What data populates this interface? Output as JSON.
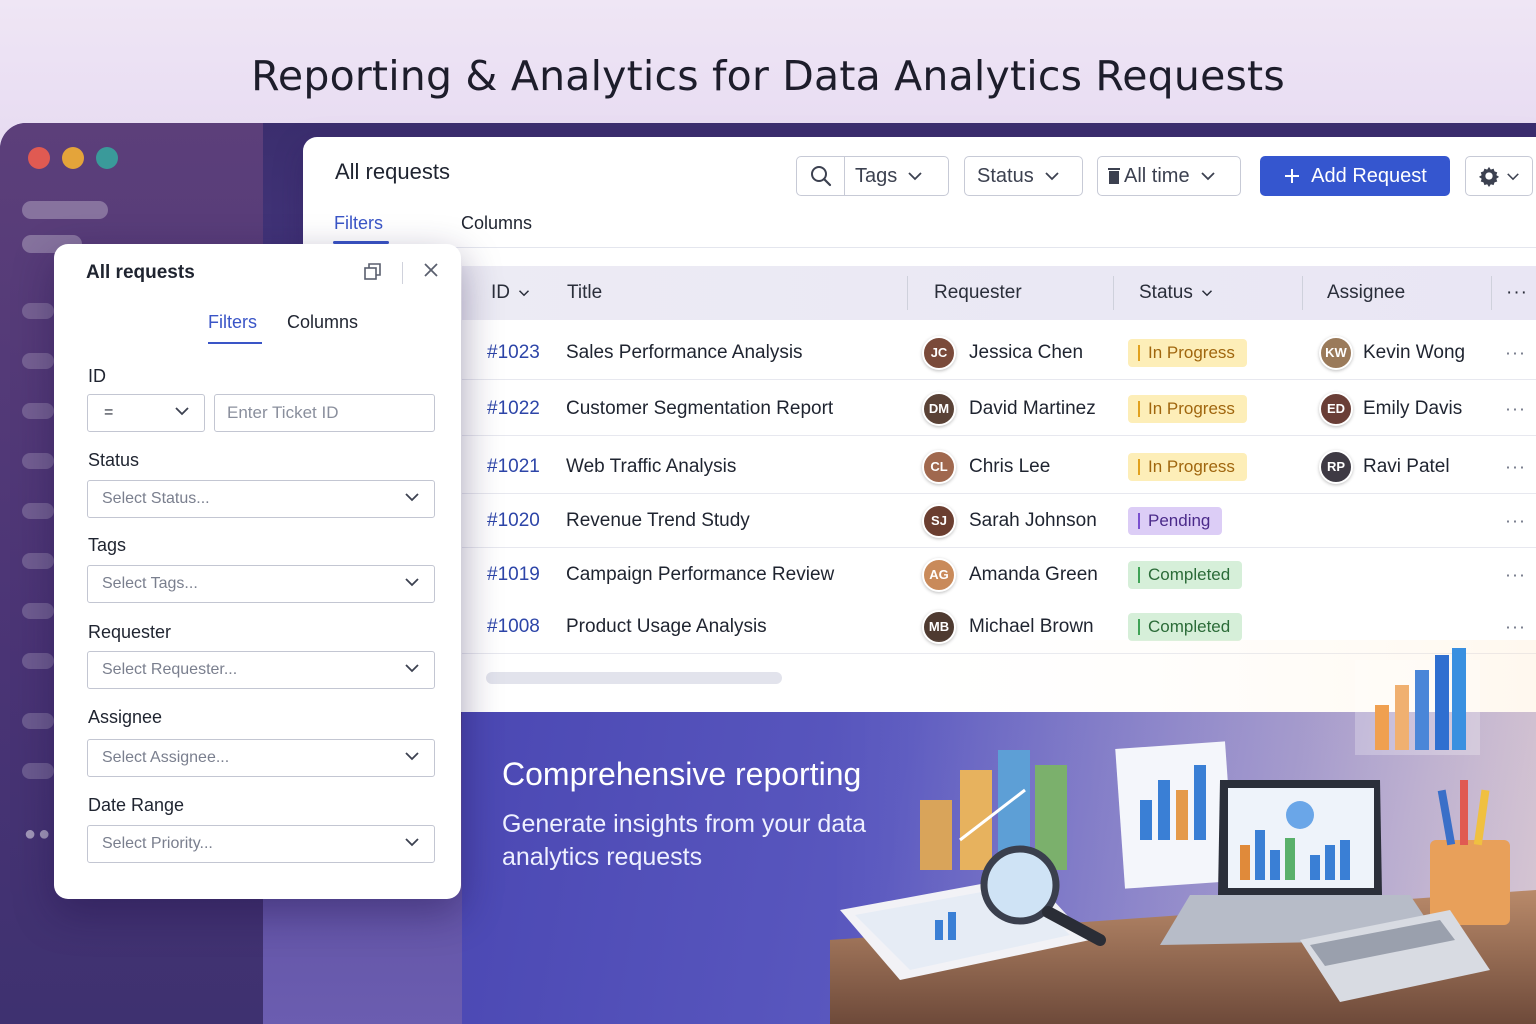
{
  "hero_title": "Reporting & Analytics for Data Analytics Requests",
  "window_dots": [
    "#e05a52",
    "#e4a43a",
    "#3a9a9a"
  ],
  "main": {
    "title": "All requests",
    "tabs": [
      {
        "label": "Filters",
        "active": true
      },
      {
        "label": "Columns",
        "active": false
      }
    ],
    "toolbar": {
      "tags_label": "Tags",
      "status_label": "Status",
      "time_label": "All time",
      "add_label": "Add Request"
    }
  },
  "table": {
    "headers": {
      "id": "ID",
      "title": "Title",
      "requester": "Requester",
      "status": "Status",
      "assignee": "Assignee"
    },
    "rows": [
      {
        "id": "#1023",
        "title": "Sales Performance Analysis",
        "requester": "Jessica Chen",
        "status": "In Progress",
        "assignee": "Kevin Wong"
      },
      {
        "id": "#1022",
        "title": "Customer Segmentation Report",
        "requester": "David Martinez",
        "status": "In Progress",
        "assignee": "Emily Davis"
      },
      {
        "id": "#1021",
        "title": "Web Traffic Analysis",
        "requester": "Chris Lee",
        "status": "In Progress",
        "assignee": "Ravi Patel"
      },
      {
        "id": "#1020",
        "title": "Revenue Trend Study",
        "requester": "Sarah Johnson",
        "status": "Pending",
        "assignee": ""
      },
      {
        "id": "#1019",
        "title": "Campaign Performance Review",
        "requester": "Amanda Green",
        "status": "Completed",
        "assignee": ""
      },
      {
        "id": "#1008",
        "title": "Product Usage Analysis",
        "requester": "Michael Brown",
        "status": "Completed",
        "assignee": ""
      }
    ],
    "status_colors": {
      "In Progress": {
        "bg": "#fdeeb8",
        "fg": "#a0660e",
        "bar": "#e1a11e"
      },
      "Pending": {
        "bg": "#dccdf6",
        "fg": "#4b2a8a",
        "bar": "#7a4fd0"
      },
      "Completed": {
        "bg": "#d6efd9",
        "fg": "#2b6b38",
        "bar": "#3fa356"
      }
    }
  },
  "hero": {
    "heading": "Comprehensive reporting",
    "text": "Generate insights from your data analytics requests"
  },
  "filter_popup": {
    "title": "All requests",
    "tabs": [
      {
        "label": "Filters",
        "active": true
      },
      {
        "label": "Columns",
        "active": false
      }
    ],
    "id_label": "ID",
    "id_operator": "=",
    "id_placeholder": "Enter Ticket ID",
    "fields": [
      {
        "label": "Status",
        "placeholder": "Select Status..."
      },
      {
        "label": "Tags",
        "placeholder": "Select Tags..."
      },
      {
        "label": "Requester",
        "placeholder": "Select Requester..."
      },
      {
        "label": "Assignee",
        "placeholder": "Select Assignee..."
      },
      {
        "label": "Date Range",
        "placeholder": "Select Priority..."
      }
    ]
  }
}
